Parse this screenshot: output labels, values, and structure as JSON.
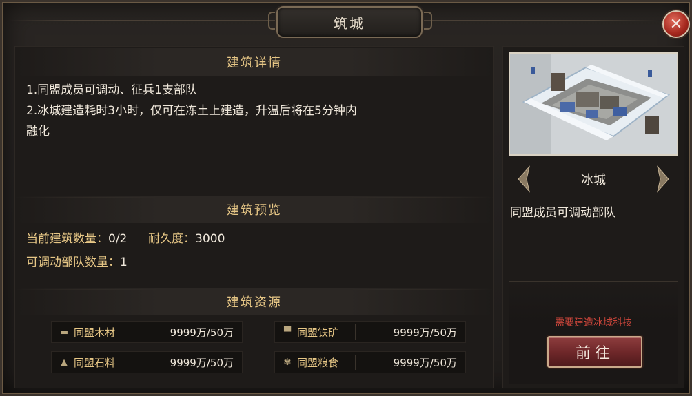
{
  "window": {
    "title": "筑城",
    "close_icon": "close-icon"
  },
  "details": {
    "header": "建筑详情",
    "lines": [
      "1.同盟成员可调动、征兵1支部队",
      "2.冰城建造耗时3小时，仅可在冻土上建造，升温后将在5分钟内",
      "融化"
    ]
  },
  "preview": {
    "header": "建筑预览",
    "count_label": "当前建筑数量：",
    "count_value": "0/2",
    "durability_label": "耐久度：",
    "durability_value": "3000",
    "troops_label": "可调动部队数量：",
    "troops_value": "1"
  },
  "resources": {
    "header": "建筑资源",
    "items": [
      {
        "icon": "wood-icon",
        "name": "同盟木材",
        "value": "9999万/50万"
      },
      {
        "icon": "iron-ore-icon",
        "name": "同盟铁矿",
        "value": "9999万/50万"
      },
      {
        "icon": "stone-icon",
        "name": "同盟石料",
        "value": "9999万/50万"
      },
      {
        "icon": "grain-icon",
        "name": "同盟粮食",
        "value": "9999万/50万"
      }
    ]
  },
  "building": {
    "name": "冰城",
    "description": "同盟成员可调动部队",
    "requirement": "需要建造冰城科技",
    "go_button": "前往",
    "prev_icon": "arrow-left-icon",
    "next_icon": "arrow-right-icon"
  },
  "colors": {
    "gold_text": "#e7c786",
    "body_text": "#efe7da",
    "warning_text": "#c9453a",
    "button_red": "#6c2628"
  }
}
